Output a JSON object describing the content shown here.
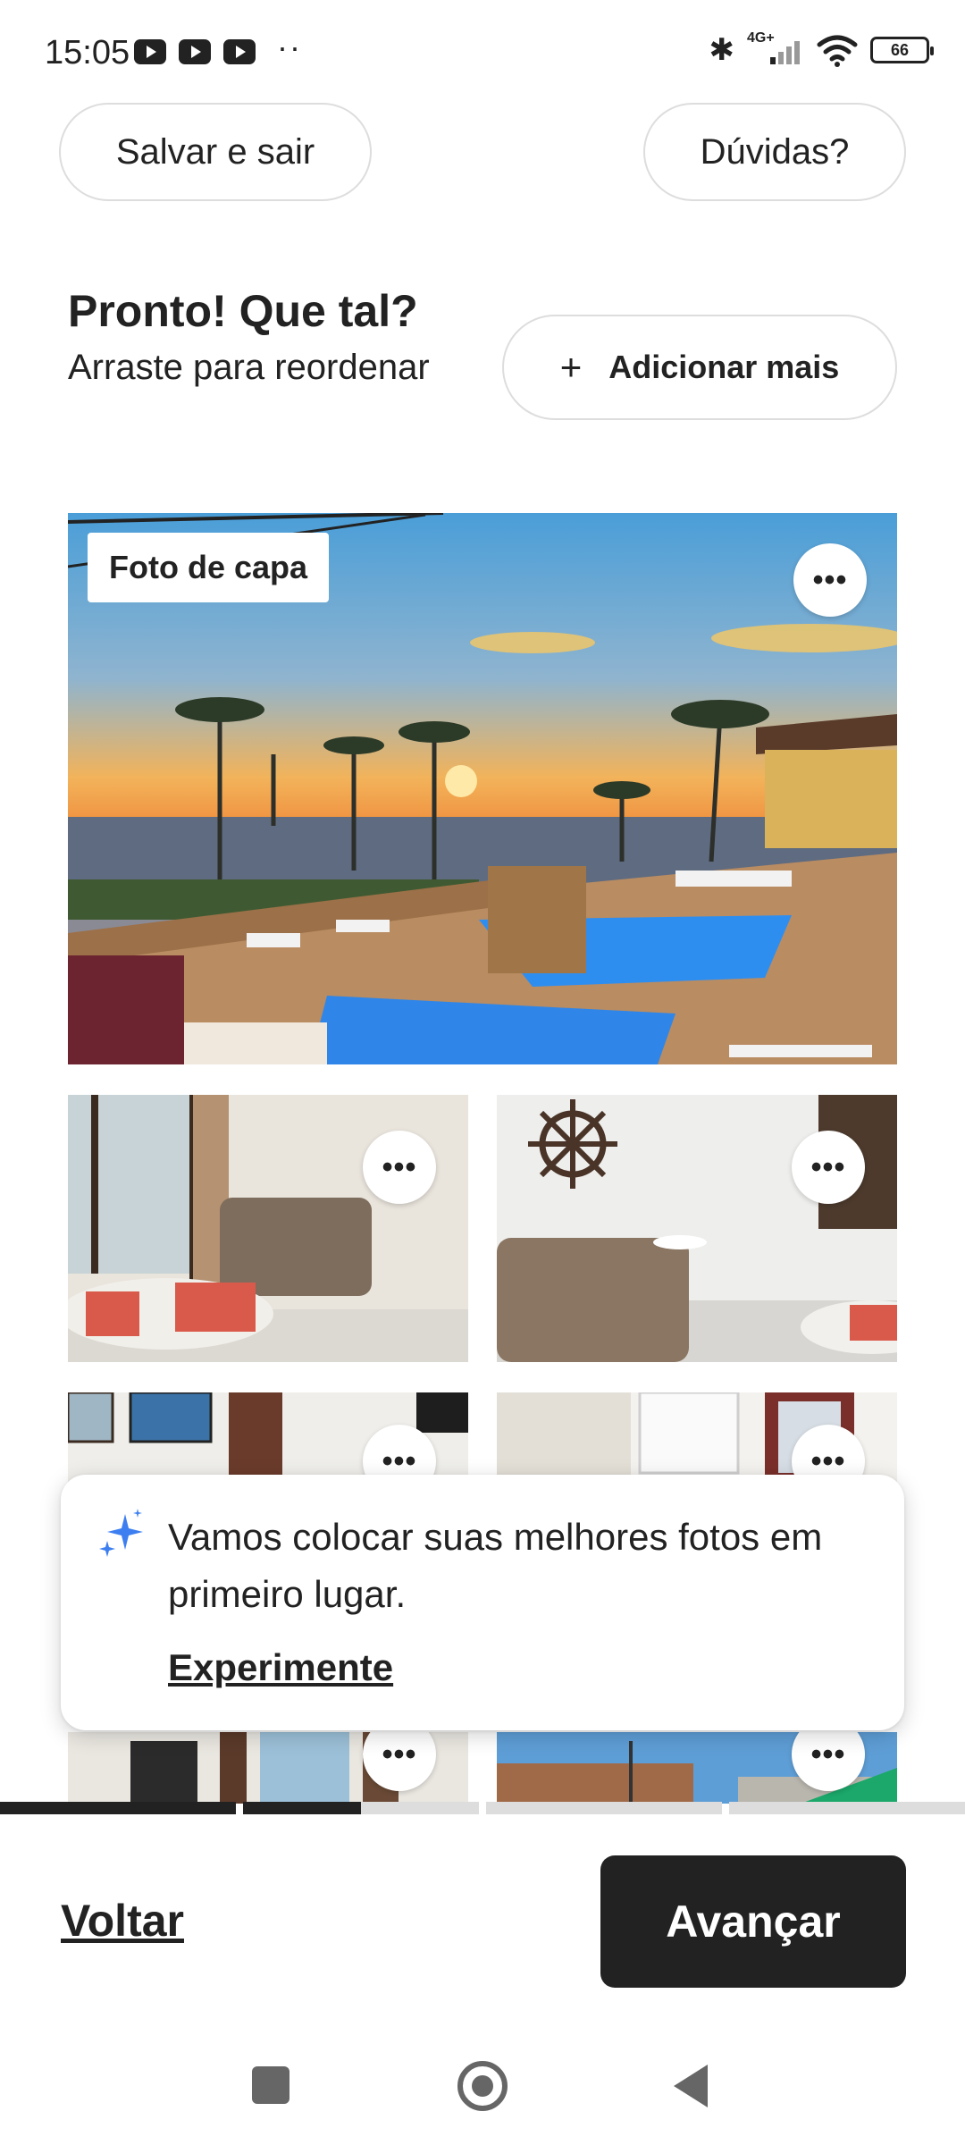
{
  "status_bar": {
    "time": "15:05",
    "network": "4G+",
    "battery": "66",
    "more": "··"
  },
  "header": {
    "save_exit_label": "Salvar e sair",
    "help_label": "Dúvidas?"
  },
  "section": {
    "title": "Pronto! Que tal?",
    "subtitle": "Arraste para reordenar",
    "add_more_label": "Adicionar mais"
  },
  "photos": {
    "cover_badge": "Foto de capa",
    "more_label": "•••"
  },
  "tip": {
    "text": "Vamos colocar suas melhores fotos em primeiro lugar.",
    "link": "Experimente"
  },
  "progress": {
    "segments": [
      1.0,
      0.5,
      0.0,
      0.0
    ],
    "color_done": "#222222",
    "color_todo": "#dddddd"
  },
  "footer": {
    "back_label": "Voltar",
    "next_label": "Avançar"
  },
  "colors": {
    "accent_dark": "#222222",
    "border": "#dddddd",
    "sparkle": "#3d7ff0"
  }
}
